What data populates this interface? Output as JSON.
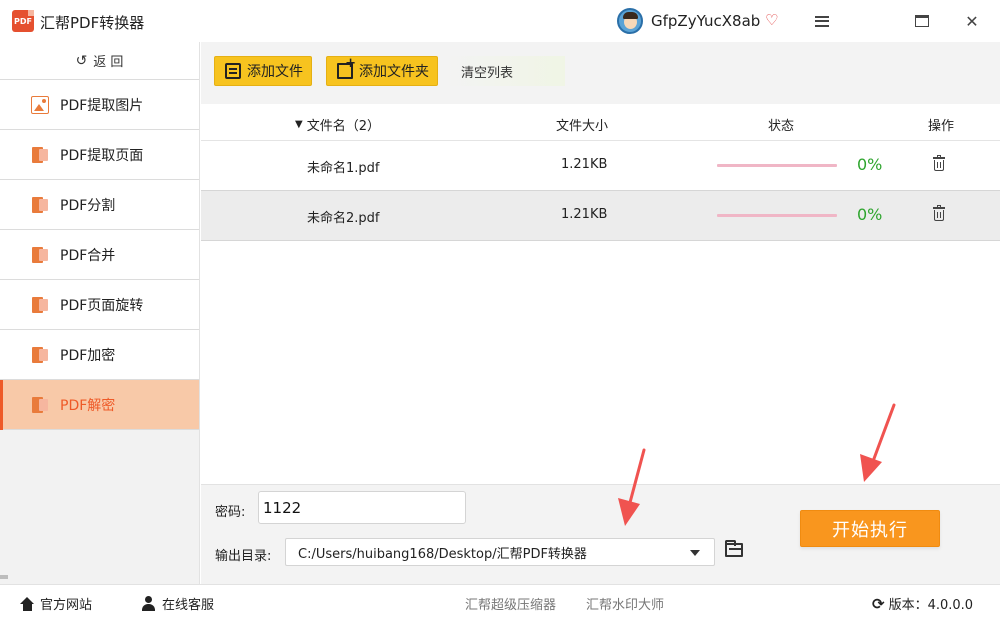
{
  "app": {
    "title": "汇帮PDF转换器",
    "logo_text": "PDF",
    "user_name": "GfpZyYucX8ab"
  },
  "window": {
    "menu_icon": "menu-icon",
    "maximize_icon": "maximize-icon",
    "close_glyph": "✕"
  },
  "sidebar": {
    "back_icon": "↺",
    "back_label": "返  回",
    "items": [
      {
        "label": "PDF提取图片",
        "icon": "image-icon",
        "active": false
      },
      {
        "label": "PDF提取页面",
        "icon": "pdf-icon",
        "active": false
      },
      {
        "label": "PDF分割",
        "icon": "pdf-icon",
        "active": false
      },
      {
        "label": "PDF合并",
        "icon": "pdf-icon",
        "active": false
      },
      {
        "label": "PDF页面旋转",
        "icon": "pdf-icon",
        "active": false
      },
      {
        "label": "PDF加密",
        "icon": "pdf-icon",
        "active": false
      },
      {
        "label": "PDF解密",
        "icon": "pdf-icon",
        "active": true
      }
    ]
  },
  "toolbar": {
    "add_file": "添加文件",
    "add_folder": "添加文件夹",
    "clear_list": "清空列表"
  },
  "table": {
    "sort_glyph": "▼",
    "headers": {
      "name": "文件名（2）",
      "size": "文件大小",
      "status": "状态",
      "ops": "操作"
    },
    "rows": [
      {
        "name": "未命名1.pdf",
        "size": "1.21KB",
        "progress": "0%"
      },
      {
        "name": "未命名2.pdf",
        "size": "1.21KB",
        "progress": "0%"
      }
    ]
  },
  "bottom": {
    "password_label": "密码:",
    "password_value": "1122",
    "output_label": "输出目录:",
    "output_path": "C:/Users/huibang168/Desktop/汇帮PDF转换器",
    "start_button": "开始执行"
  },
  "statusbar": {
    "official_site": "官方网站",
    "online_service": "在线客服",
    "compressor": "汇帮超级压缩器",
    "watermark": "汇帮水印大师",
    "version": "版本：4.0.0.0",
    "refresh_glyph": "⟳"
  },
  "colors": {
    "accent_orange": "#f9961e",
    "toolbar_yellow": "#f7c31f",
    "active_nav_bg": "#f8c9a8",
    "active_nav_text": "#ee5a28",
    "progress_green": "#2ea52e",
    "progress_track": "#f0b6c6",
    "arrow_red": "#f05350"
  }
}
